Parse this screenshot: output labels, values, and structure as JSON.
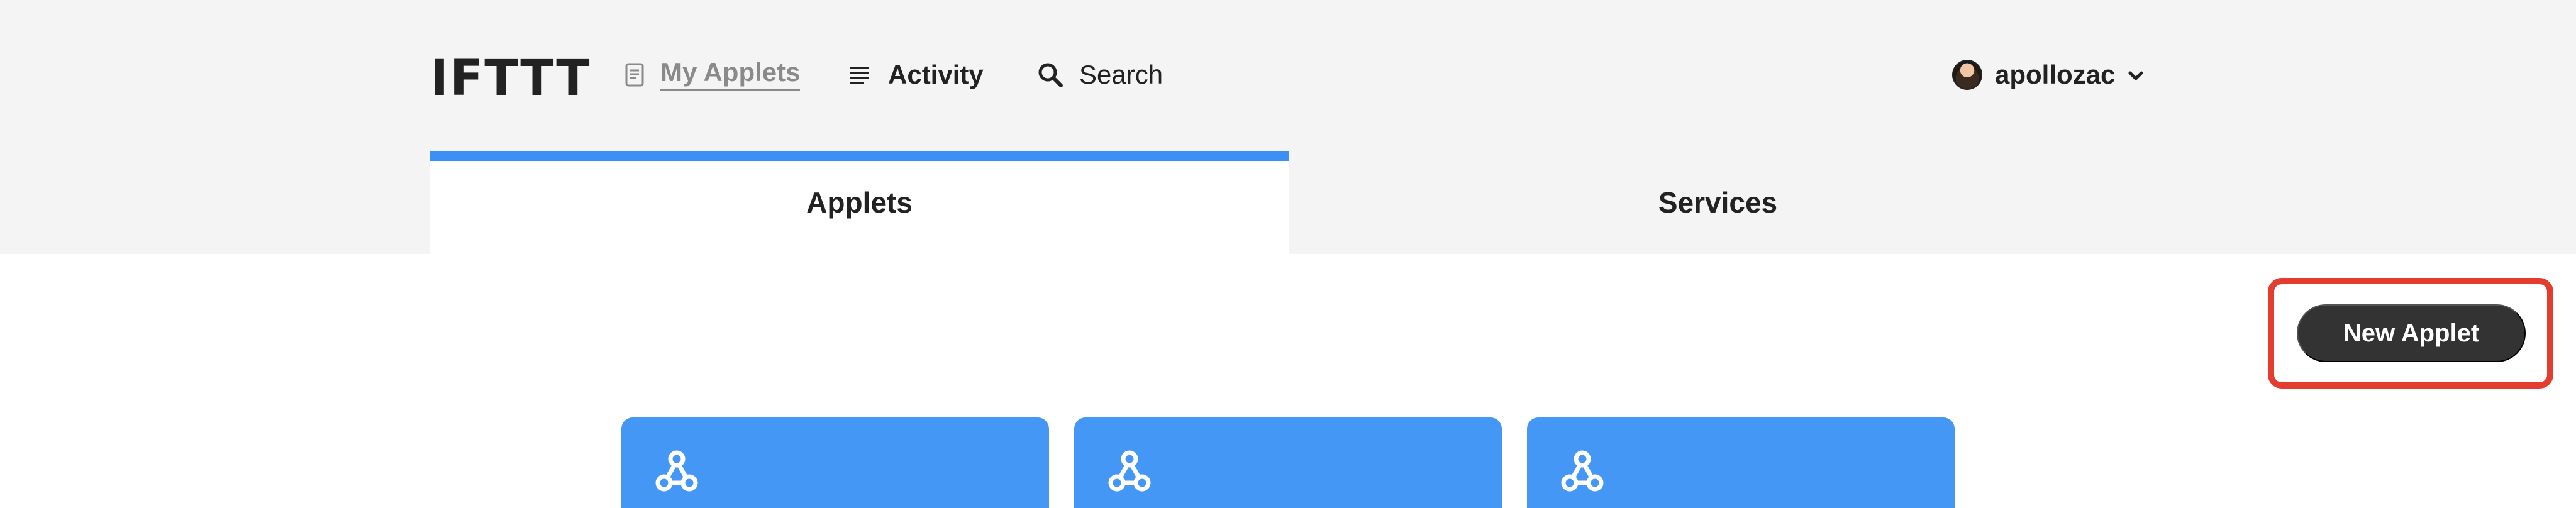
{
  "brand": {
    "logo_text": "IFTTT"
  },
  "nav": {
    "my_applets": {
      "label": "My Applets",
      "icon": "document-icon"
    },
    "activity": {
      "label": "Activity",
      "icon": "list-icon"
    },
    "search": {
      "label": "Search",
      "icon": "search-icon"
    }
  },
  "user": {
    "username": "apollozac",
    "avatar": "avatar",
    "dropdown_icon": "chevron-down-icon"
  },
  "tabs": [
    {
      "label": "Applets",
      "active": true
    },
    {
      "label": "Services",
      "active": false
    }
  ],
  "actions": {
    "new_applet_label": "New Applet"
  },
  "cards": [
    {
      "icon": "webhooks-icon"
    },
    {
      "icon": "webhooks-icon"
    },
    {
      "icon": "webhooks-icon"
    }
  ],
  "colors": {
    "active_tab_accent": "#3b8ff5",
    "card_blue": "#4597f6",
    "button_dark": "#333333",
    "annotation_red": "#e43d2f"
  }
}
